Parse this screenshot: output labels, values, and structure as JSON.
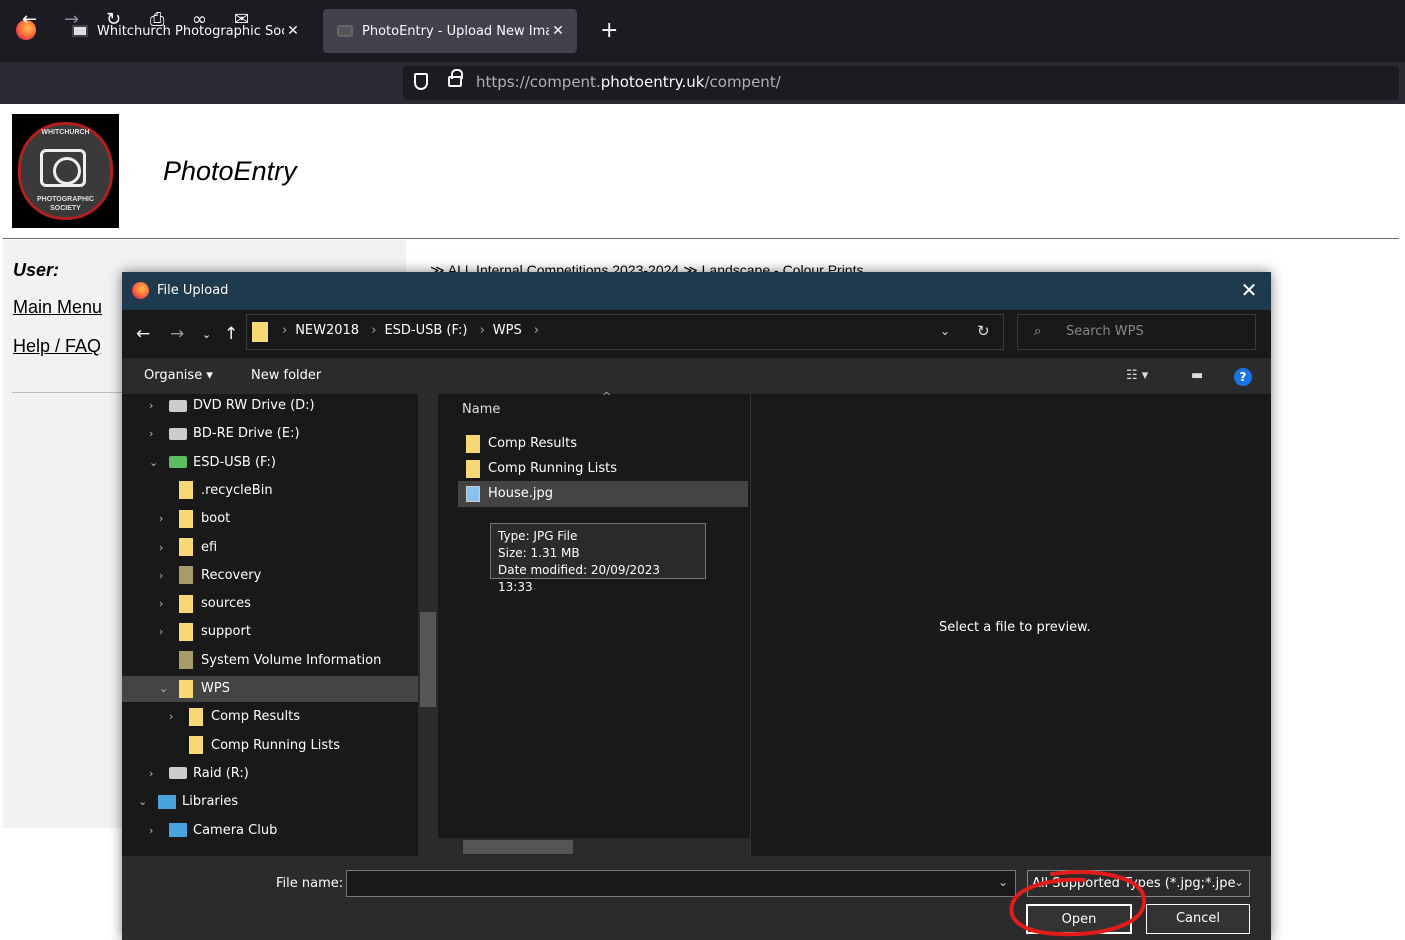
{
  "browser": {
    "tabs": [
      {
        "title": "Whitchurch Photographic Socie",
        "active": false
      },
      {
        "title": "PhotoEntry - Upload New Imag",
        "active": true
      }
    ],
    "url_prefix": "https://compent.",
    "url_domain": "photoentry.uk",
    "url_suffix": "/compent/"
  },
  "page": {
    "logo_text_top": "WHITCHURCH",
    "logo_text_bottom": "PHOTOGRAPHIC",
    "logo_text_bottom2": "SOCIETY",
    "site_title": "PhotoEntry",
    "user_label": "User:",
    "links": [
      "Main Menu",
      "Help / FAQ"
    ],
    "breadcrumb": "≫ ALL Internal Competitions 2023-2024 ≫ Landscape - Colour Prints"
  },
  "dialog": {
    "title": "File Upload",
    "path": [
      "NEW2018",
      "ESD-USB (F:)",
      "WPS"
    ],
    "search_placeholder": "Search WPS",
    "organise_label": "Organise ▾",
    "new_folder_label": "New folder",
    "tree": [
      {
        "label": "DVD RW Drive (D:)",
        "kind": "drive",
        "indent": 0,
        "chevron": "›"
      },
      {
        "label": "BD-RE Drive (E:)",
        "kind": "drive",
        "indent": 0,
        "chevron": "›"
      },
      {
        "label": "ESD-USB (F:)",
        "kind": "usb",
        "indent": 0,
        "chevron": "⌄"
      },
      {
        "label": ".recycleBin",
        "kind": "folder",
        "indent": 1,
        "chevron": ""
      },
      {
        "label": "boot",
        "kind": "folder",
        "indent": 1,
        "chevron": "›"
      },
      {
        "label": "efi",
        "kind": "folder",
        "indent": 1,
        "chevron": "›"
      },
      {
        "label": "Recovery",
        "kind": "folder-dark",
        "indent": 1,
        "chevron": "›"
      },
      {
        "label": "sources",
        "kind": "folder",
        "indent": 1,
        "chevron": "›"
      },
      {
        "label": "support",
        "kind": "folder",
        "indent": 1,
        "chevron": "›"
      },
      {
        "label": "System Volume Information",
        "kind": "folder-dark",
        "indent": 1,
        "chevron": ""
      },
      {
        "label": "WPS",
        "kind": "folder",
        "indent": 1,
        "chevron": "⌄",
        "selected": true
      },
      {
        "label": "Comp Results",
        "kind": "folder",
        "indent": 2,
        "chevron": "›"
      },
      {
        "label": "Comp Running Lists",
        "kind": "folder",
        "indent": 2,
        "chevron": ""
      },
      {
        "label": "Raid (R:)",
        "kind": "drive",
        "indent": 0,
        "chevron": "›"
      },
      {
        "label": "Libraries",
        "kind": "lib",
        "indent": -1,
        "chevron": "⌄"
      },
      {
        "label": "Camera Club",
        "kind": "lib",
        "indent": 0,
        "chevron": "›"
      }
    ],
    "column_name": "Name",
    "files": [
      {
        "label": "Comp Results",
        "kind": "folder"
      },
      {
        "label": "Comp Running Lists",
        "kind": "folder"
      },
      {
        "label": "House.jpg",
        "kind": "jpg",
        "selected": true
      }
    ],
    "tooltip": {
      "type": "Type: JPG File",
      "size": "Size: 1.31 MB",
      "date": "Date modified: 20/09/2023 13:33"
    },
    "preview_text": "Select a file to preview.",
    "file_name_label": "File name:",
    "file_name_value": "",
    "file_type": "All Supported Types (*.jpg;*.jpe",
    "open_label": "Open",
    "cancel_label": "Cancel"
  }
}
